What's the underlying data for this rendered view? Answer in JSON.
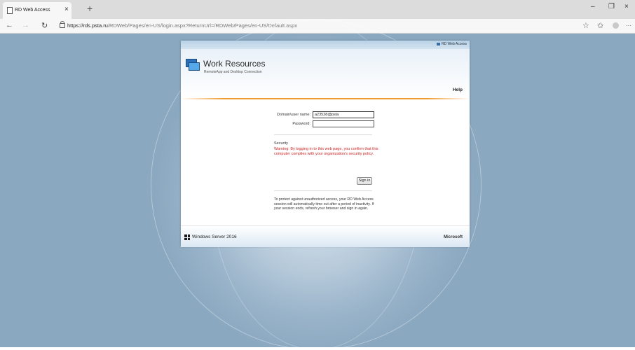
{
  "browser": {
    "tab_title": "RD Web Access",
    "tab_close": "×",
    "new_tab": "+",
    "url_host": "https://rds.psta.ru",
    "url_path": "/RDWeb/Pages/en-US/login.aspx?ReturnUrl=/RDWeb/Pages/en-US/Default.aspx",
    "minimize": "–",
    "maximize": "❐",
    "close": "×",
    "back": "←",
    "forward": "→",
    "reload": "↻",
    "favorite": "☆",
    "favorites": "✩",
    "more": "···"
  },
  "banner": {
    "label": "RD Web Access"
  },
  "header": {
    "title": "Work Resources",
    "subtitle": "RemoteApp and Desktop Connection",
    "help": "Help"
  },
  "form": {
    "username_label": "Domain\\user name:",
    "username_value": "a23528@psta",
    "password_label": "Password:",
    "password_value": "",
    "security_title": "Security",
    "security_warning": "Warning: By logging in to this web page, you confirm that this computer complies with your organization's security policy.",
    "signin_label": "Sign in",
    "timeout_note": "To protect against unauthorized access, your RD Web Access session will automatically time out after a period of inactivity. If your session ends, refresh your browser and sign in again."
  },
  "footer": {
    "product": "Windows Server 2016",
    "vendor": "Microsoft"
  },
  "icons": {
    "page": "page-icon",
    "lock": "lock-icon",
    "app": "remote-desktop-icon",
    "windows": "windows-logo-icon"
  },
  "colors": {
    "accent_orange": "#f29b2f",
    "warning_red": "#cc2222",
    "banner_blue": "#b9d2e6"
  }
}
